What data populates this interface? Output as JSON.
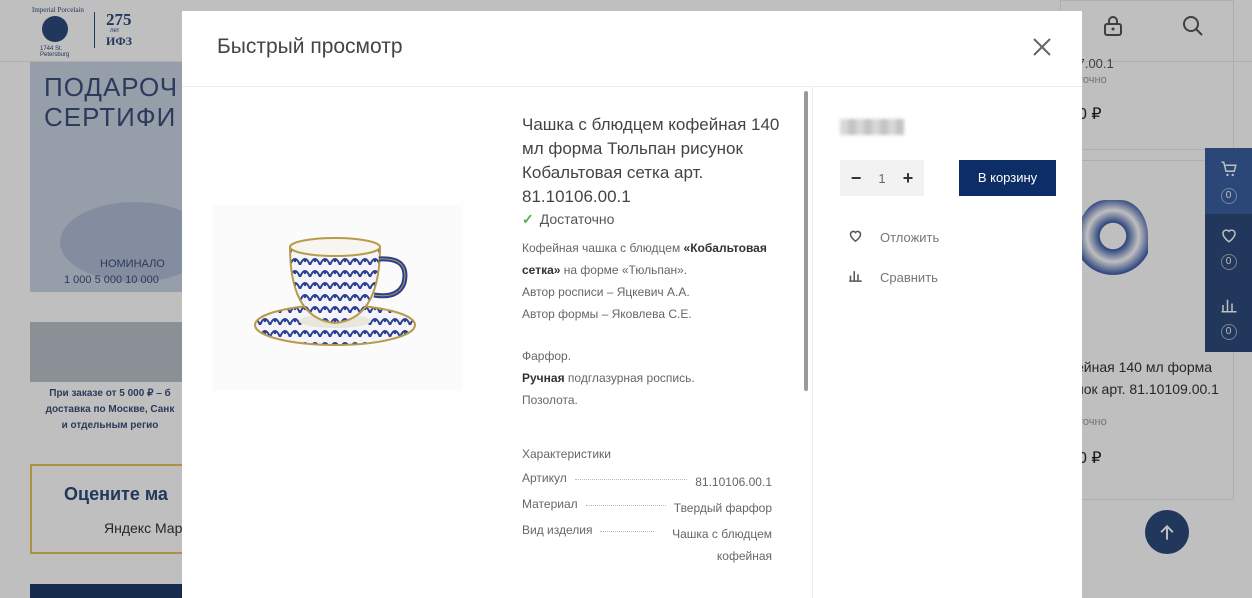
{
  "background": {
    "logo": {
      "top_text": "Imperial Porcelain",
      "bottom_text": "1744 St. Petersburg",
      "number": "275",
      "sub": "лет",
      "abbr": "ИФЗ"
    },
    "header_icons": [
      "lock-icon",
      "search-icon"
    ],
    "cert_banner": {
      "line1": "ПОДАРОЧ",
      "line2": "СЕРТИФИ",
      "nominal": "НОМИНАЛО",
      "values": "1 000   5 000   10 000"
    },
    "city_banner": {
      "line1": "При заказе от 5 000 ₽ – б",
      "line2": "доставка по Москве, Санк",
      "line3": "и отдельным регио"
    },
    "rating_banner": {
      "title": "Оцените ма",
      "brand": "Яндекс Марке"
    },
    "right_product_1": {
      "code": ".7.00.1",
      "stock": "точно",
      "price": "0 ₽"
    },
    "right_product_2": {
      "name": "ейная 140 мл форма\nнок арт. 81.10109.00.1",
      "stock": "точно",
      "price": "0 ₽"
    },
    "side_widget": {
      "cart_count": "0",
      "fav_count": "0",
      "compare_count": "0"
    }
  },
  "modal": {
    "title": "Быстрый просмотр",
    "product": {
      "name": "Чашка с блюдцем кофейная 140 мл форма Тюльпан рисунок Кобальтовая сетка арт. 81.10106.00.1",
      "stock": "Достаточно",
      "desc_part1": "Кофейная чашка с блюдцем ",
      "desc_bold": "«Кобальтовая сетка»",
      "desc_part2": " на форме «Тюльпан».",
      "painter": "Автор росписи – Яцкевич А.А.",
      "former": "Автор формы – Яковлева С.Е.",
      "material_line": "Фарфор.",
      "paint_bold": "Ручная",
      "paint_rest": " подглазурная роспись.",
      "gilding": "Позолота.",
      "chars_title": "Характеристики",
      "chars": [
        {
          "key": "Артикул",
          "value": "81.10106.00.1"
        },
        {
          "key": "Материал",
          "value": "Твердый фарфор"
        },
        {
          "key": "Вид изделия",
          "value": "Чашка с блюдцем кофейная"
        }
      ]
    },
    "buy": {
      "quantity": "1",
      "minus": "−",
      "plus": "+",
      "cart_button": "В корзину",
      "postpone": "Отложить",
      "compare": "Сравнить"
    }
  }
}
